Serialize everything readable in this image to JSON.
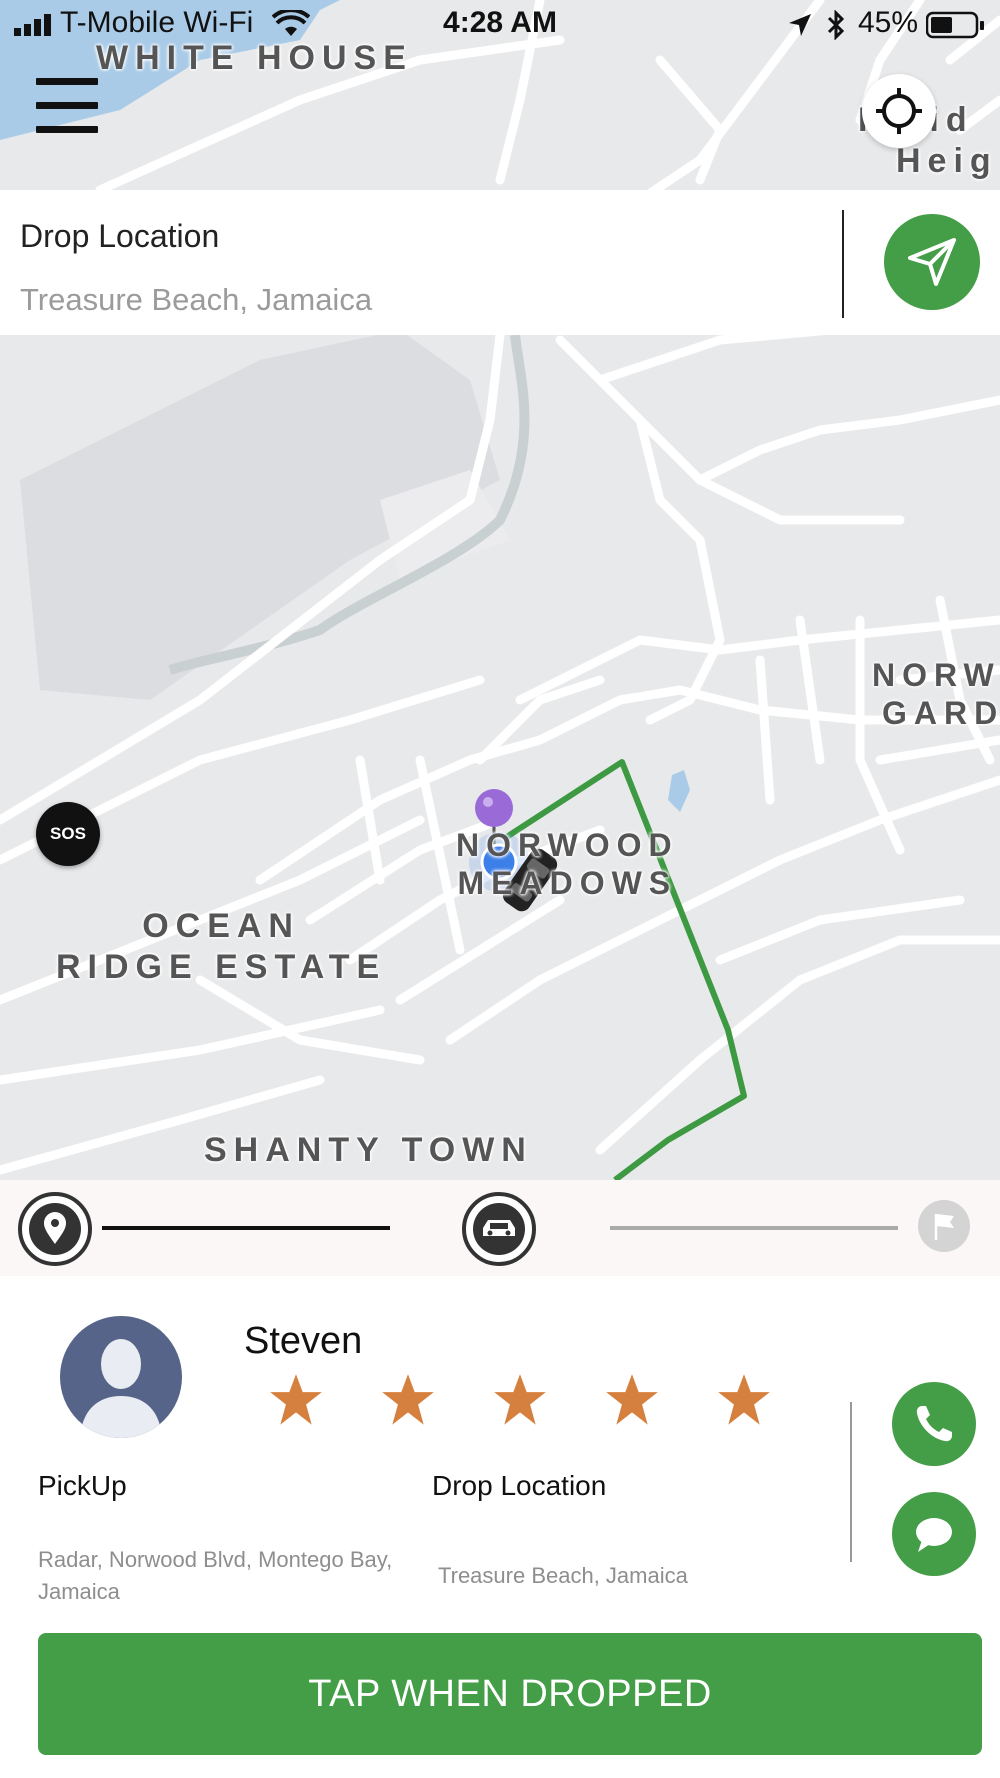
{
  "status_bar": {
    "carrier": "T-Mobile Wi-Fi",
    "time": "4:28 AM",
    "battery": "45%"
  },
  "map": {
    "labels": {
      "white_house": "WHITE HOUSE",
      "providence_line1": "P  vid",
      "providence_line2": "Heig",
      "norwood_gardens_line1": "NORW",
      "norwood_gardens_line2": "GARD",
      "norwood_meadows_line1": "NORWOOD",
      "norwood_meadows_line2": "MEADOWS",
      "ocean_ridge_line1": "OCEAN",
      "ocean_ridge_line2": "RIDGE ESTATE",
      "shanty_town": "SHANTY TOWN"
    },
    "sos_label": "SOS",
    "route_color": "#3e9a42",
    "user_dot_color": "#3c7fe8",
    "pin_color": "#9a6ad6"
  },
  "drop_card": {
    "title": "Drop Location",
    "value": "Treasure Beach, Jamaica"
  },
  "trip_progress": {
    "steps": [
      "pickup-pin-icon",
      "car-icon",
      "finish-flag-icon"
    ],
    "current_step": 2
  },
  "driver": {
    "name": "Steven",
    "rating": 5,
    "star_color": "#d5803e"
  },
  "pickup": {
    "label": "PickUp",
    "address": "Radar, Norwood Blvd, Montego Bay, Jamaica"
  },
  "dropoff": {
    "label": "Drop Location",
    "address": "Treasure Beach, Jamaica"
  },
  "actions": {
    "primary": "TAP WHEN DROPPED"
  },
  "colors": {
    "accent_green": "#449d47",
    "water": "#a9cbe8"
  }
}
